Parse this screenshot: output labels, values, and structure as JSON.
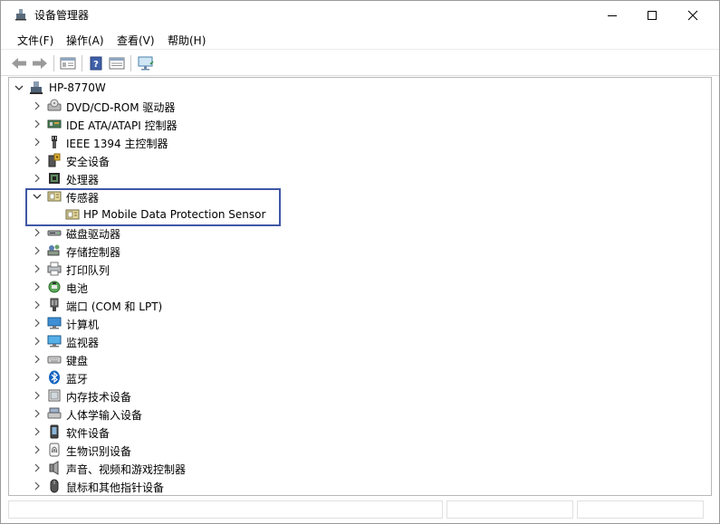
{
  "window": {
    "title": "设备管理器"
  },
  "menu": [
    "文件(F)",
    "操作(A)",
    "查看(V)",
    "帮助(H)"
  ],
  "tree": {
    "root": "HP-8770W",
    "categories": [
      {
        "label": "DVD/CD-ROM 驱动器",
        "icon": "dvd-drive-icon"
      },
      {
        "label": "IDE ATA/ATAPI 控制器",
        "icon": "ide-controller-icon"
      },
      {
        "label": "IEEE 1394 主控制器",
        "icon": "firewire-icon"
      },
      {
        "label": "安全设备",
        "icon": "security-device-icon"
      },
      {
        "label": "处理器",
        "icon": "processor-icon"
      },
      {
        "label": "传感器",
        "icon": "sensor-icon",
        "expanded": true,
        "children": [
          "HP Mobile Data Protection Sensor"
        ]
      },
      {
        "label": "磁盘驱动器",
        "icon": "disk-drive-icon"
      },
      {
        "label": "存储控制器",
        "icon": "storage-controller-icon"
      },
      {
        "label": "打印队列",
        "icon": "printer-icon"
      },
      {
        "label": "电池",
        "icon": "battery-icon"
      },
      {
        "label": "端口 (COM 和 LPT)",
        "icon": "port-icon"
      },
      {
        "label": "计算机",
        "icon": "computer-icon"
      },
      {
        "label": "监视器",
        "icon": "monitor-icon"
      },
      {
        "label": "键盘",
        "icon": "keyboard-icon"
      },
      {
        "label": "蓝牙",
        "icon": "bluetooth-icon"
      },
      {
        "label": "内存技术设备",
        "icon": "memory-device-icon"
      },
      {
        "label": "人体学输入设备",
        "icon": "hid-icon"
      },
      {
        "label": "软件设备",
        "icon": "software-device-icon"
      },
      {
        "label": "生物识别设备",
        "icon": "biometric-icon"
      },
      {
        "label": "声音、视频和游戏控制器",
        "icon": "sound-icon"
      },
      {
        "label": "鼠标和其他指针设备",
        "icon": "mouse-icon"
      }
    ]
  },
  "colors": {
    "highlight_border": "#3f57a6",
    "scroll_thumb": "#c2c2c2"
  }
}
